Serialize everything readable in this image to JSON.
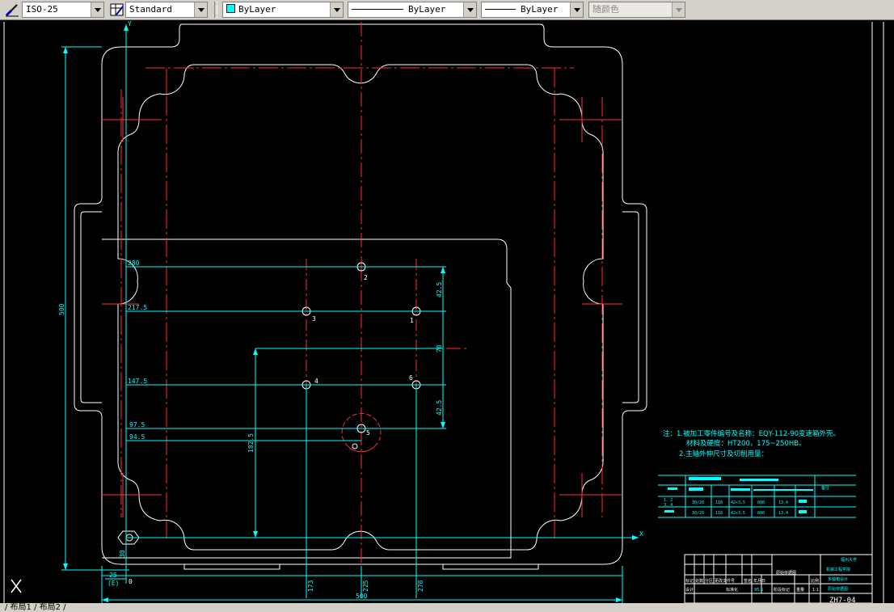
{
  "toolbar": {
    "dimstyle": "ISO-25",
    "tablestyle": "Standard",
    "layer": "ByLayer",
    "linetype": "ByLayer",
    "lineweight": "ByLayer",
    "plotstyle": "随颜色"
  },
  "dims": {
    "d280": "280",
    "d2175": "217.5",
    "d1475": "147.5",
    "d975": "97.5",
    "d945": "94.5",
    "d425a": "42.5",
    "d70": "70",
    "d425b": "42.5",
    "d1825": "182.5",
    "d500v": "500",
    "d30": "30",
    "d25": "25",
    "dE": "(E)",
    "d0": "0",
    "d173": "173",
    "d225": "225",
    "d278": "278",
    "d500h": "500",
    "axisX": "X",
    "axisY": "Y"
  },
  "holes": {
    "h1": "1",
    "h2": "2",
    "h3": "3",
    "h4": "4",
    "h5": "5",
    "h6": "6"
  },
  "notes": {
    "line1": "注：1.被加工零件编号及名称：EQY-112-90变速箱外壳。",
    "line2": "材料及硬度：HT200，175~250HB。",
    "line3": "2.主轴外伸尺寸及切削用量："
  },
  "spindle_table": {
    "header_right": "备注",
    "row1_ids": "1、2",
    "row1_ids_b": "3、4",
    "row2_ids": "",
    "col_values": [
      "30/20",
      "118",
      "42×3.5",
      "800",
      "13.4"
    ]
  },
  "title_block": {
    "col_title": "原始依据图",
    "univ1": "福州大学",
    "univ2": "机械工程学院",
    "proj1": "多轴箱设计",
    "proj2": "原始依据图",
    "scale": "1:1",
    "weight": "95.6",
    "drawing_no": "ZH7-04",
    "hdr": [
      "标记",
      "处数",
      "分区",
      "更改文件号",
      "签名",
      "年月日"
    ],
    "r2": [
      "设计",
      "标准化",
      "阶段标记",
      "重量",
      "比例"
    ]
  },
  "tabs": "/ 布局1 / 布局2 /"
}
